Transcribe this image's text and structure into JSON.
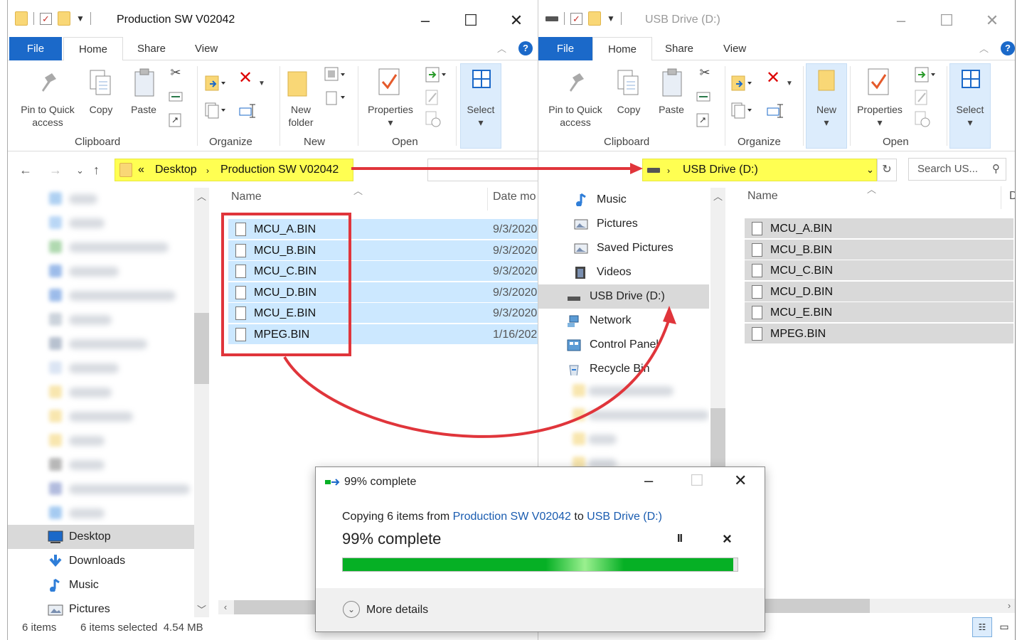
{
  "left_window": {
    "title": "Production SW V02042",
    "tabs": [
      "File",
      "Home",
      "Share",
      "View"
    ],
    "ribbon": {
      "pin_label_1": "Pin to Quick",
      "pin_label_2": "access",
      "copy": "Copy",
      "paste": "Paste",
      "new_folder_1": "New",
      "new_folder_2": "folder",
      "properties": "Properties",
      "select": "Select",
      "groups": [
        "Clipboard",
        "Organize",
        "New",
        "Open"
      ]
    },
    "address": {
      "prefix": "«",
      "crumbs": [
        "Desktop",
        "Production SW V02042"
      ]
    },
    "nav_items": [
      "Desktop",
      "Downloads",
      "Music",
      "Pictures"
    ],
    "columns": {
      "name": "Name",
      "date": "Date mo"
    },
    "files": [
      {
        "name": "MCU_A.BIN",
        "date": "9/3/2020"
      },
      {
        "name": "MCU_B.BIN",
        "date": "9/3/2020"
      },
      {
        "name": "MCU_C.BIN",
        "date": "9/3/2020"
      },
      {
        "name": "MCU_D.BIN",
        "date": "9/3/2020"
      },
      {
        "name": "MCU_E.BIN",
        "date": "9/3/2020"
      },
      {
        "name": "MPEG.BIN",
        "date": "1/16/2021"
      }
    ],
    "status": {
      "items": "6 items",
      "selected": "6 items selected  4.54 MB"
    }
  },
  "right_window": {
    "title": "USB Drive (D:)",
    "tabs": [
      "File",
      "Home",
      "Share",
      "View"
    ],
    "ribbon": {
      "pin_label_1": "Pin to Quick",
      "pin_label_2": "access",
      "copy": "Copy",
      "paste": "Paste",
      "new": "New",
      "properties": "Properties",
      "select": "Select",
      "groups": [
        "Clipboard",
        "Organize",
        "Open"
      ]
    },
    "address": {
      "crumb": "USB Drive (D:)"
    },
    "search_placeholder": "Search US...",
    "nav_items": [
      "Music",
      "Pictures",
      "Saved Pictures",
      "Videos",
      "USB Drive (D:)",
      "Network",
      "Control Panel",
      "Recycle Bin"
    ],
    "columns": {
      "name": "Name",
      "date": "D"
    },
    "files": [
      "MCU_A.BIN",
      "MCU_B.BIN",
      "MCU_C.BIN",
      "MCU_D.BIN",
      "MCU_E.BIN",
      "MPEG.BIN"
    ]
  },
  "dialog": {
    "title": "99% complete",
    "copying_prefix": "Copying 6 items from ",
    "source": "Production SW V02042",
    "to_word": " to ",
    "dest": "USB Drive (D:)",
    "big_status": "99% complete",
    "progress": 0.99,
    "pause": "II",
    "cancel": "×",
    "more_details": "More details"
  },
  "colors": {
    "accent": "#1b69c9",
    "highlight": "#ffff52",
    "annotation_red": "#e0353b",
    "progress_green": "#06b025",
    "selection_blue": "#cce8ff"
  }
}
